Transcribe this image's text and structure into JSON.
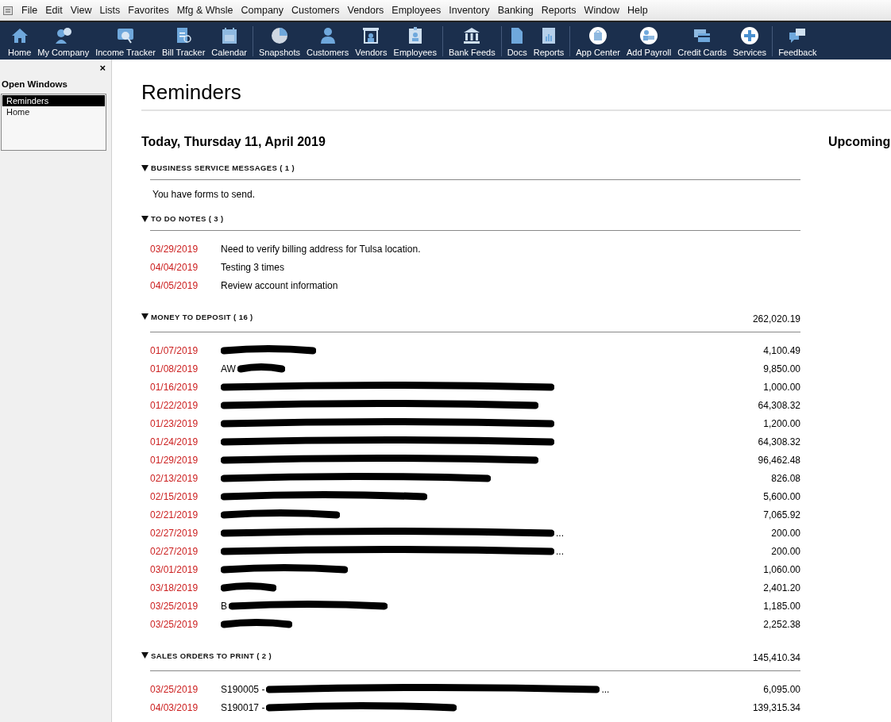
{
  "menu_bar": {
    "items": [
      "File",
      "Edit",
      "View",
      "Lists",
      "Favorites",
      "Mfg & Whsle",
      "Company",
      "Customers",
      "Vendors",
      "Employees",
      "Inventory",
      "Banking",
      "Reports",
      "Window",
      "Help"
    ]
  },
  "toolbar": {
    "groups": [
      [
        {
          "label": "Home"
        },
        {
          "label": "My Company"
        },
        {
          "label": "Income Tracker"
        },
        {
          "label": "Bill Tracker"
        },
        {
          "label": "Calendar"
        }
      ],
      [
        {
          "label": "Snapshots"
        },
        {
          "label": "Customers"
        },
        {
          "label": "Vendors"
        },
        {
          "label": "Employees"
        }
      ],
      [
        {
          "label": "Bank Feeds"
        }
      ],
      [
        {
          "label": "Docs"
        },
        {
          "label": "Reports"
        }
      ],
      [
        {
          "label": "App Center"
        },
        {
          "label": "Add Payroll"
        },
        {
          "label": "Credit Cards"
        },
        {
          "label": "Services"
        }
      ],
      [
        {
          "label": "Feedback"
        }
      ]
    ]
  },
  "sidebar": {
    "close": "×",
    "title": "Open Windows",
    "items": [
      {
        "label": "Reminders",
        "selected": true
      },
      {
        "label": "Home",
        "selected": false
      }
    ]
  },
  "page": {
    "title": "Reminders",
    "today": "Today, Thursday 11, April 2019",
    "upcoming": "Upcoming",
    "sections": [
      {
        "title": "BUSINESS SERVICE MESSAGES ( 1 )",
        "expanded": true,
        "message": "You have forms to send."
      },
      {
        "title": "TO DO NOTES ( 3 )",
        "expanded": true,
        "rows": [
          {
            "date": "03/29/2019",
            "description": "Need to verify billing address for Tulsa location."
          },
          {
            "date": "04/04/2019",
            "description": "Testing 3 times"
          },
          {
            "date": "04/05/2019",
            "description": "Review account information"
          }
        ]
      },
      {
        "title": "MONEY TO DEPOSIT ( 16 )",
        "expanded": true,
        "total": "262,020.19",
        "rows": [
          {
            "date": "01/07/2019",
            "redacted": true,
            "amount": "4,100.49"
          },
          {
            "date": "01/08/2019",
            "description": "AW",
            "redacted": true,
            "amount": "9,850.00"
          },
          {
            "date": "01/16/2019",
            "redacted": true,
            "amount": "1,000.00"
          },
          {
            "date": "01/22/2019",
            "redacted": true,
            "amount": "64,308.32"
          },
          {
            "date": "01/23/2019",
            "redacted": true,
            "amount": "1,200.00"
          },
          {
            "date": "01/24/2019",
            "redacted": true,
            "amount": "64,308.32"
          },
          {
            "date": "01/29/2019",
            "redacted": true,
            "amount": "96,462.48"
          },
          {
            "date": "02/13/2019",
            "redacted": true,
            "amount": "826.08"
          },
          {
            "date": "02/15/2019",
            "redacted": true,
            "amount": "5,600.00"
          },
          {
            "date": "02/21/2019",
            "redacted": true,
            "amount": "7,065.92"
          },
          {
            "date": "02/27/2019",
            "redacted": true,
            "tail": "...",
            "amount": "200.00"
          },
          {
            "date": "02/27/2019",
            "redacted": true,
            "tail": "...",
            "amount": "200.00"
          },
          {
            "date": "03/01/2019",
            "redacted": true,
            "amount": "1,060.00"
          },
          {
            "date": "03/18/2019",
            "redacted": true,
            "amount": "2,401.20"
          },
          {
            "date": "03/25/2019",
            "description": "B",
            "redacted": true,
            "amount": "1,185.00"
          },
          {
            "date": "03/25/2019",
            "redacted": true,
            "amount": "2,252.38"
          }
        ]
      },
      {
        "title": "SALES ORDERS TO PRINT ( 2 )",
        "expanded": true,
        "total": "145,410.34",
        "rows": [
          {
            "date": "03/25/2019",
            "description": "S190005 -",
            "redacted": true,
            "tail": "...",
            "amount": "6,095.00"
          },
          {
            "date": "04/03/2019",
            "description": "S190017 -",
            "redacted": true,
            "amount": "139,315.34"
          }
        ]
      }
    ]
  }
}
